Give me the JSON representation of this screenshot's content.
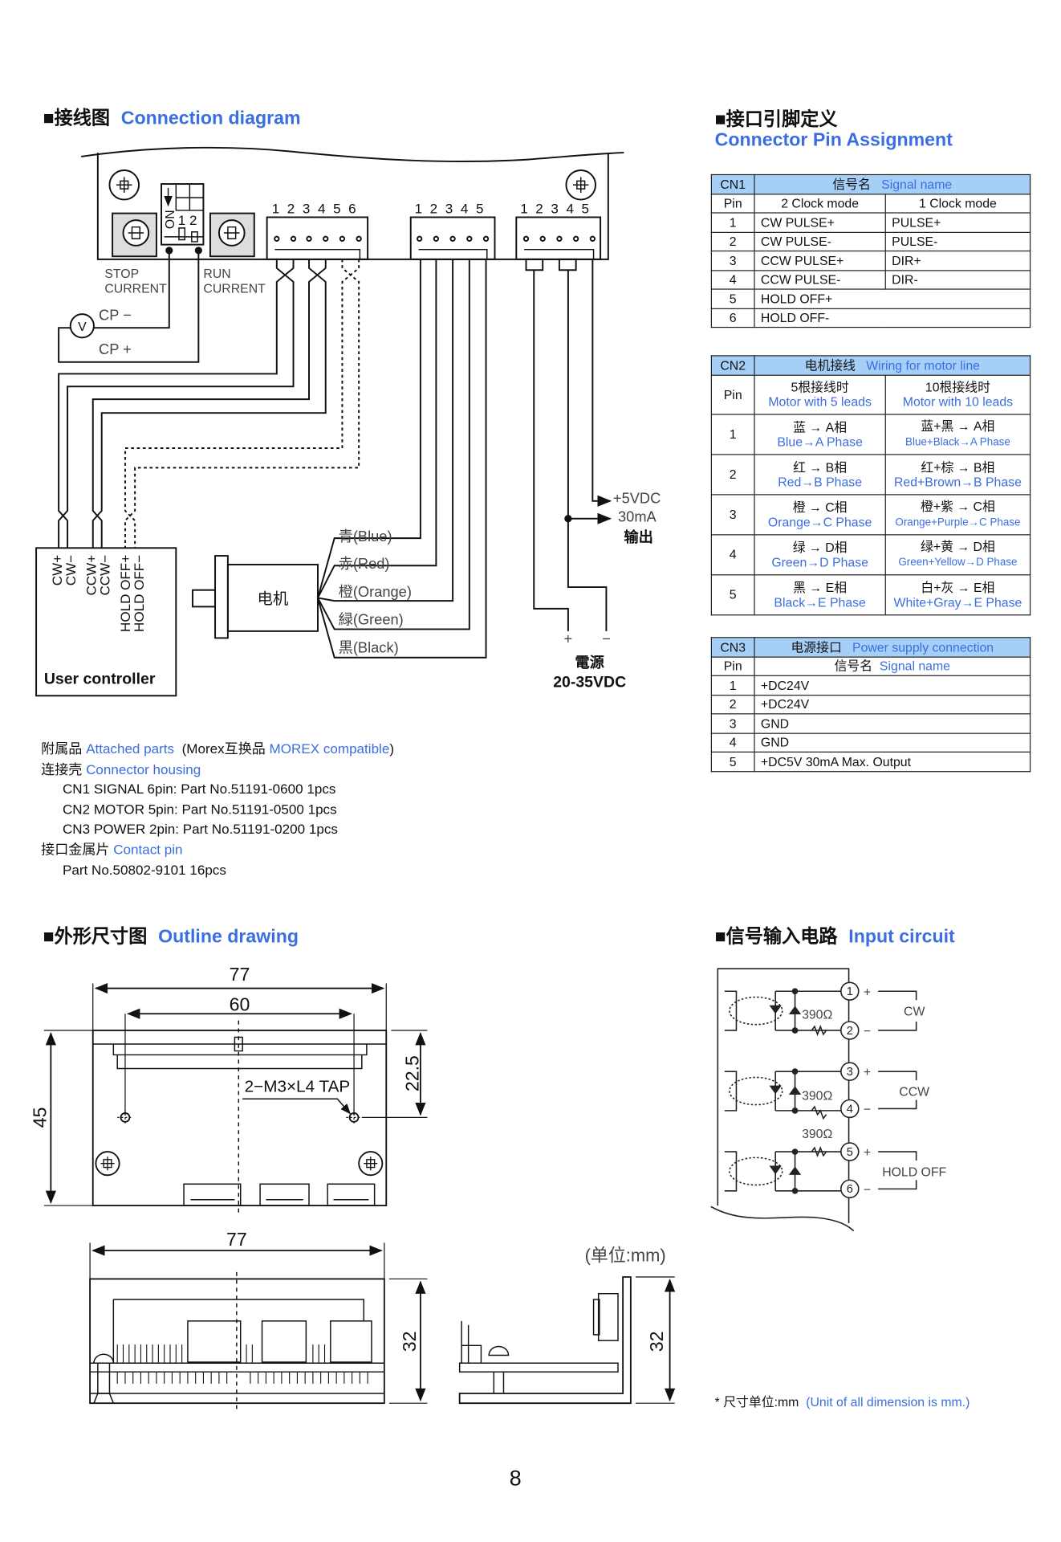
{
  "headings": {
    "connection": {
      "cn": "■接线图",
      "en": "Connection diagram"
    },
    "pin_assignment": {
      "cn": "■接口引脚定义",
      "en": "Connector Pin Assignment"
    },
    "outline": {
      "cn": "■外形尺寸图",
      "en": "Outline drawing"
    },
    "input_circuit": {
      "cn": "■信号输入电路",
      "en": "Input circuit"
    }
  },
  "connection_diagram": {
    "cn1_pins": "1 2 3 4 5 6",
    "cn2_pins": "1 2 3 4 5",
    "cn3_pins": "1 2 3 4 5",
    "dip_on": "ON",
    "dip_numbers": "1 2",
    "stop_current": [
      "STOP",
      "CURRENT"
    ],
    "run_current": [
      "RUN",
      "CURRENT"
    ],
    "voltmeter": "V",
    "cp_minus": "CP −",
    "cp_plus": "CP +",
    "controller_signals": [
      "CW+",
      "CW−",
      "CCW+",
      "CCW−",
      "HOLD OFF+",
      "HOLD OFF−"
    ],
    "controller_label": "User controller",
    "motor_label": "电机",
    "motor_wires": [
      "青(Blue)",
      "赤(Red)",
      "橙(Orange)",
      "緑(Green)",
      "黒(Black)"
    ],
    "output_lines": [
      "+5VDC",
      "30mA",
      "输出"
    ],
    "power_plus": "+",
    "power_minus": "−",
    "power_label": "電源",
    "power_range": "20-35VDC"
  },
  "cn1": {
    "id": "CN1",
    "header_cn": "信号名",
    "header_en": "Signal name",
    "pin_label": "Pin",
    "col_2clock": "2 Clock mode",
    "col_1clock": "1 Clock mode",
    "rows": [
      {
        "pin": "1",
        "two": "CW PULSE+",
        "one": "PULSE+"
      },
      {
        "pin": "2",
        "two": "CW PULSE-",
        "one": "PULSE-"
      },
      {
        "pin": "3",
        "two": "CCW PULSE+",
        "one": "DIR+"
      },
      {
        "pin": "4",
        "two": "CCW PULSE-",
        "one": "DIR-"
      },
      {
        "pin": "5",
        "two": "HOLD OFF+"
      },
      {
        "pin": "6",
        "two": "HOLD OFF-"
      }
    ]
  },
  "cn2": {
    "id": "CN2",
    "header_cn": "电机接线",
    "header_en": "Wiring for motor line",
    "pin_label": "Pin",
    "col5_cn": "5根接线时",
    "col5_en": "Motor with 5 leads",
    "col10_cn": "10根接线时",
    "col10_en": "Motor with 10 leads",
    "rows": [
      {
        "pin": "1",
        "c5_cn": "蓝 → A相",
        "c5_en": "Blue→A Phase",
        "c10_cn": "蓝+黑 → A相",
        "c10_en": "Blue+Black→A Phase"
      },
      {
        "pin": "2",
        "c5_cn": "红 → B相",
        "c5_en": "Red→B Phase",
        "c10_cn": "红+棕 → B相",
        "c10_en": "Red+Brown→B Phase"
      },
      {
        "pin": "3",
        "c5_cn": "橙 → C相",
        "c5_en": "Orange→C Phase",
        "c10_cn": "橙+紫 → C相",
        "c10_en": "Orange+Purple→C Phase"
      },
      {
        "pin": "4",
        "c5_cn": "绿 → D相",
        "c5_en": "Green→D Phase",
        "c10_cn": "绿+黄 → D相",
        "c10_en": "Green+Yellow→D Phase"
      },
      {
        "pin": "5",
        "c5_cn": "黑 → E相",
        "c5_en": "Black→E Phase",
        "c10_cn": "白+灰 → E相",
        "c10_en": "White+Gray→E Phase"
      }
    ]
  },
  "cn3": {
    "id": "CN3",
    "header_cn": "电源接口",
    "header_en": "Power supply connection",
    "pin_label": "Pin",
    "signal_cn": "信号名",
    "signal_en": "Signal name",
    "rows": [
      {
        "pin": "1",
        "signal": "+DC24V"
      },
      {
        "pin": "2",
        "signal": "+DC24V"
      },
      {
        "pin": "3",
        "signal": "GND"
      },
      {
        "pin": "4",
        "signal": "GND"
      },
      {
        "pin": "5",
        "signal": "+DC5V 30mA Max. Output"
      }
    ]
  },
  "attached_parts": {
    "title_cn": "附属品",
    "title_en": "Attached parts",
    "morex_cn": "(Morex互换品",
    "morex_en": "MOREX compatible",
    "morex_close": ")",
    "housing_cn": "连接壳",
    "housing_en": "Connector housing",
    "housing_items": [
      "CN1 SIGNAL 6pin: Part No.51191-0600 1pcs",
      "CN2 MOTOR 5pin: Part No.51191-0500 1pcs",
      "CN3 POWER 2pin: Part No.51191-0200 1pcs"
    ],
    "contact_cn": "接口金属片",
    "contact_en": "Contact pin",
    "contact_item": "Part No.50802-9101 16pcs"
  },
  "outline_drawing": {
    "top_width": "77",
    "hole_pitch": "60",
    "height": "45",
    "hole_offset": "22.5",
    "tap_note": "2−M3×L4 TAP",
    "front_width": "77",
    "front_height": "32",
    "side_height": "32",
    "unit_note": "(单位:mm)"
  },
  "input_circuit": {
    "terminals": [
      "1",
      "2",
      "3",
      "4",
      "5",
      "6"
    ],
    "resistor": "390Ω",
    "plus": "+",
    "minus": "−",
    "signals": [
      "CW",
      "CCW",
      "HOLD OFF"
    ]
  },
  "footnote": {
    "cn": "* 尺寸单位:mm",
    "en": "(Unit of all dimension is mm.)"
  },
  "page_number": "8",
  "colors": {
    "accent_blue": "#3b6ee0",
    "table_header": "#a6cff7"
  }
}
